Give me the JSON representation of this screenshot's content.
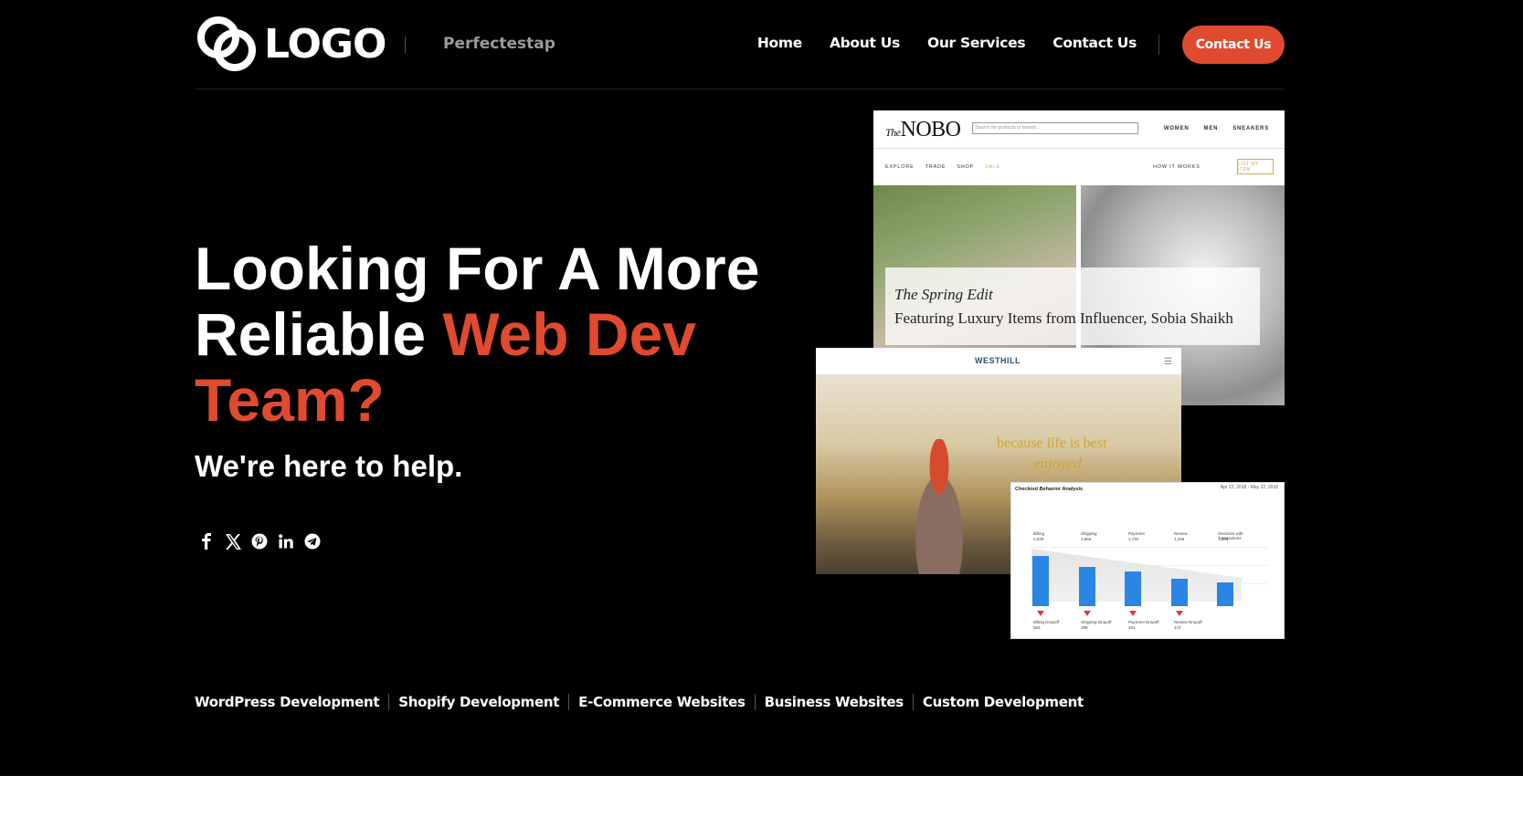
{
  "header": {
    "logo_text": "LOGO",
    "tagline": "Perfectestap",
    "nav": [
      "Home",
      "About Us",
      "Our Services",
      "Contact Us"
    ],
    "cta_label": "Contact Us"
  },
  "hero": {
    "headline_line1": "Looking For A More",
    "headline_line2_plain": "Reliable ",
    "headline_line2_accent": "Web Dev",
    "headline_line3_accent": "Team?",
    "subhead": "We're here to help.",
    "social_icons": [
      "facebook-icon",
      "x-icon",
      "pinterest-icon",
      "linkedin-icon",
      "telegram-icon"
    ]
  },
  "services": [
    "WordPress Development",
    "Shopify Development",
    "E-Commerce Websites",
    "Business Websites",
    "Custom Development"
  ],
  "mockups": {
    "nobo": {
      "brand_prefix": "The",
      "brand": "NOBO",
      "search_placeholder": "Search for products or brands...",
      "top_links": [
        "WOMEN",
        "MEN",
        "SNEAKERS"
      ],
      "sub_links": [
        "EXPLORE",
        "TRADE",
        "SHOP",
        "SALE"
      ],
      "how_it_works": "HOW IT WORKS",
      "list_item": "LIST MY ITEM",
      "feature_title": "The Spring Edit",
      "feature_subtitle": "Featuring Luxury Items from Influencer, Sobia Shaikh"
    },
    "westhill": {
      "logo": "WESTHILL",
      "tagline_line1": "because life is best",
      "tagline_line2": "enjoyed"
    },
    "analytics": {
      "title": "Checkout Behavior Analysis",
      "date_range": "Apr 22, 2018 - May 22, 2018",
      "steps": [
        {
          "name": "Billing",
          "value": "2,535"
        },
        {
          "name": "Shipping",
          "value": "1,966"
        },
        {
          "name": "Payment",
          "value": "1,734"
        },
        {
          "name": "Review",
          "value": "1,335"
        },
        {
          "name": "Sessions with Transactions",
          "value": "1,203"
        }
      ],
      "dropoffs": [
        {
          "name": "Billing Dropoff",
          "value": "563"
        },
        {
          "name": "Shipping Dropoff",
          "value": "299"
        },
        {
          "name": "Payment Dropoff",
          "value": "401"
        },
        {
          "name": "Review Dropoff",
          "value": "174"
        }
      ]
    }
  },
  "colors": {
    "accent": "#e04a2f",
    "background": "#000000"
  }
}
